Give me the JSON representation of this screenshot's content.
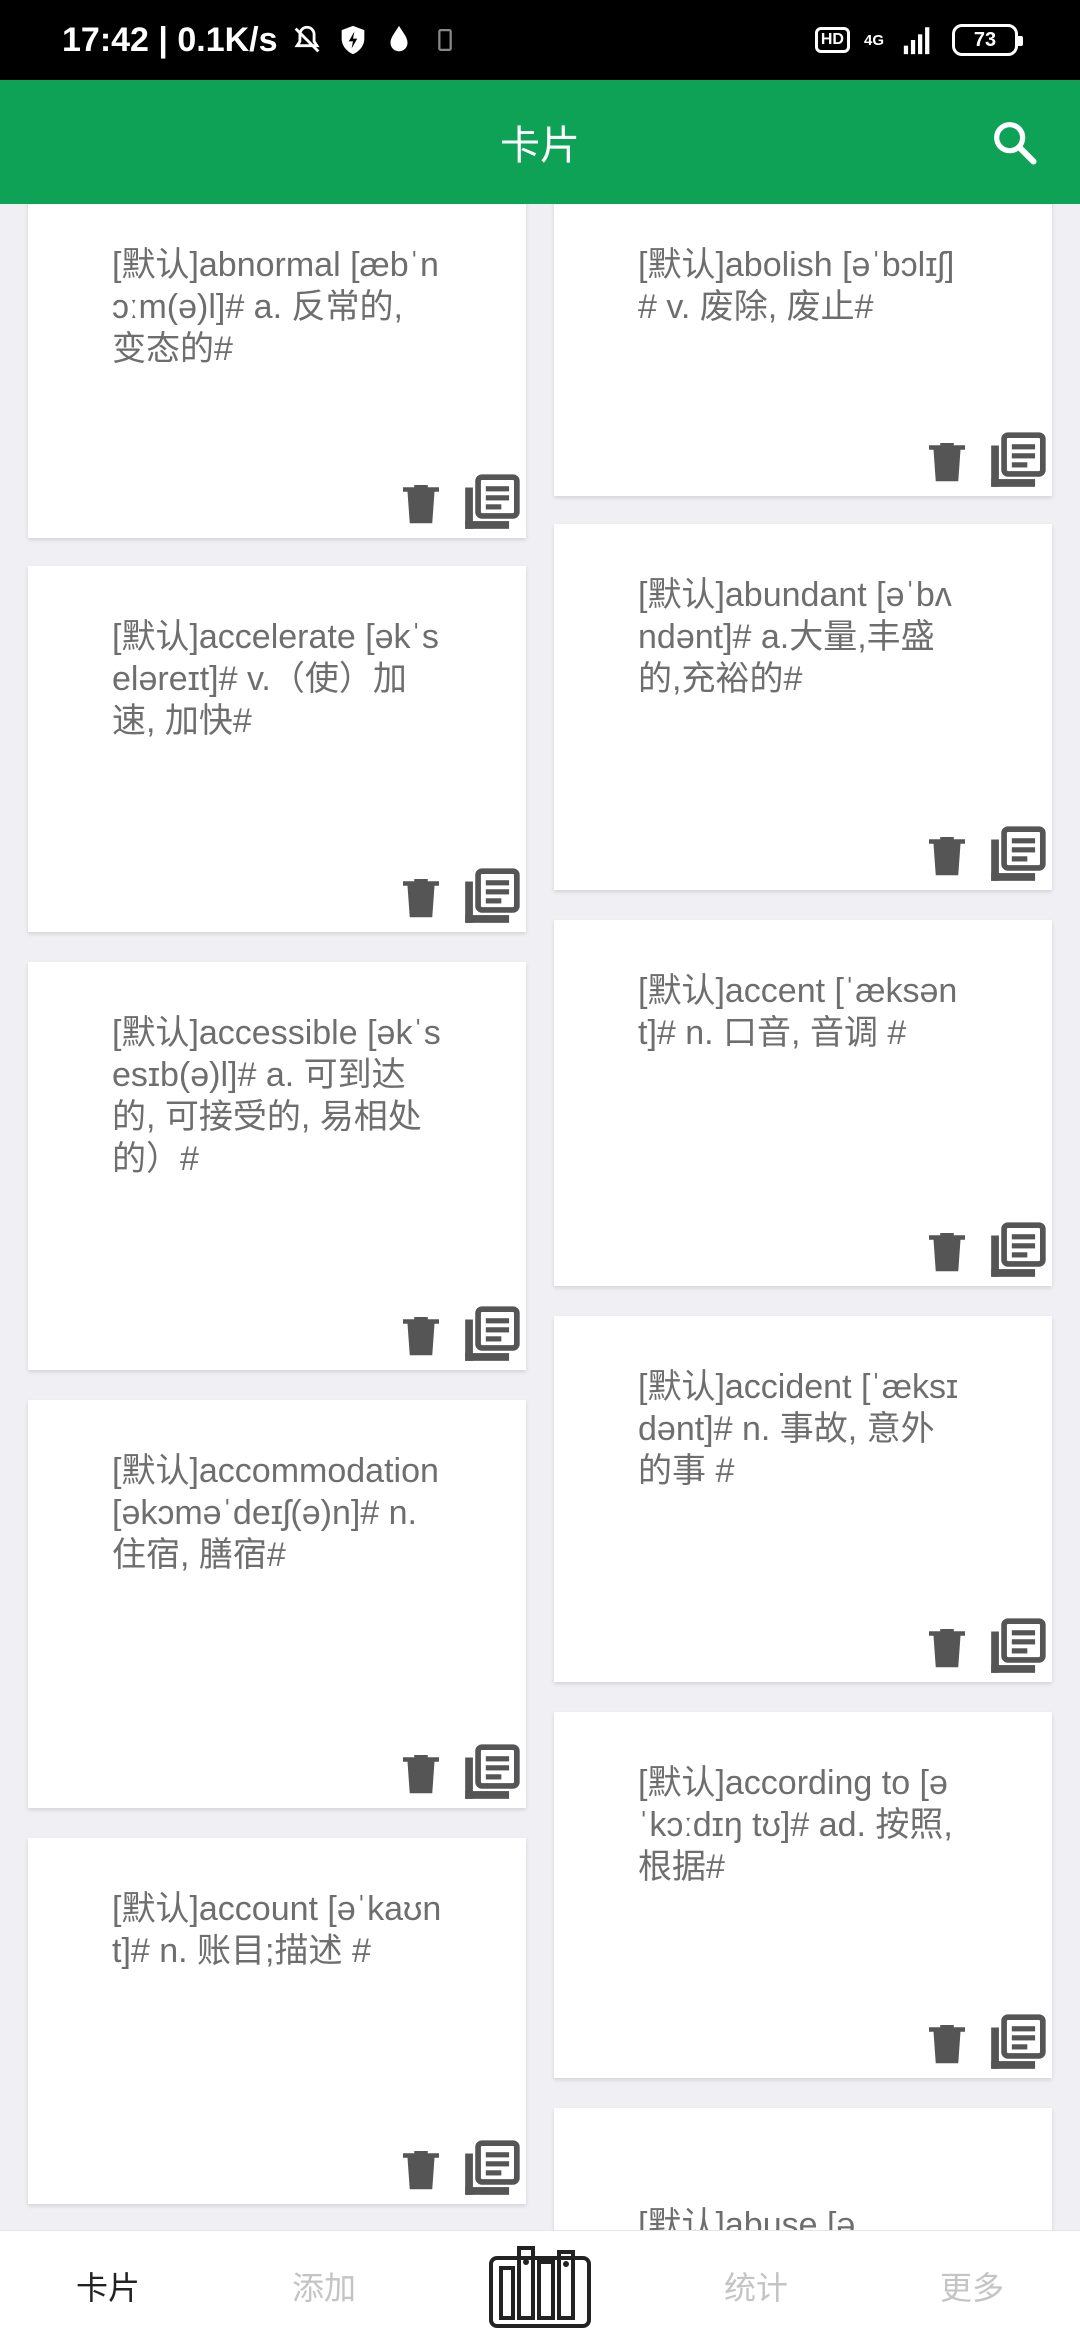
{
  "status_bar": {
    "time_speed": "17:42 | 0.1K/s",
    "hd": "HD",
    "network": "4G",
    "battery": "73"
  },
  "app_bar": {
    "title": "卡片"
  },
  "cards_left": [
    {
      "text": "[默认]abnormal [æbˈnɔːm(ə)l]# a. 反常的, 变态的#"
    },
    {
      "text": "[默认]accelerate [əkˈseləreɪt]# v.（使）加速, 加快#"
    },
    {
      "text": "[默认]accessible [əkˈsesɪb(ə)l]# a. 可到达的, 可接受的, 易相处的）#"
    },
    {
      "text": "[默认]accommodation [əkɔməˈdeɪʃ(ə)n]# n.住宿, 膳宿#"
    },
    {
      "text": "[默认]account [əˈkaʊnt]# n. 账目;描述 #"
    }
  ],
  "cards_right": [
    {
      "text": "[默认]abolish [əˈbɔlɪʃ]# v. 废除, 废止#"
    },
    {
      "text": "[默认]abundant [əˈbʌndənt]# a.大量,丰盛的,充裕的#"
    },
    {
      "text": "[默认]accent [ˈæksənt]# n. 口音, 音调 #"
    },
    {
      "text": "[默认]accident [ˈæksɪdənt]# n. 事故, 意外的事 #"
    },
    {
      "text": "[默认]according to [əˈkɔːdɪŋ tʊ]# ad. 按照, 根据#"
    },
    {
      "text": "[默认]abuse [ə"
    }
  ],
  "bottom_nav": {
    "cards": "卡片",
    "add": "添加",
    "stats": "统计",
    "more": "更多"
  },
  "colors": {
    "accent": "#0ea257",
    "card_text": "#6e6e6e",
    "icon": "#555555"
  }
}
